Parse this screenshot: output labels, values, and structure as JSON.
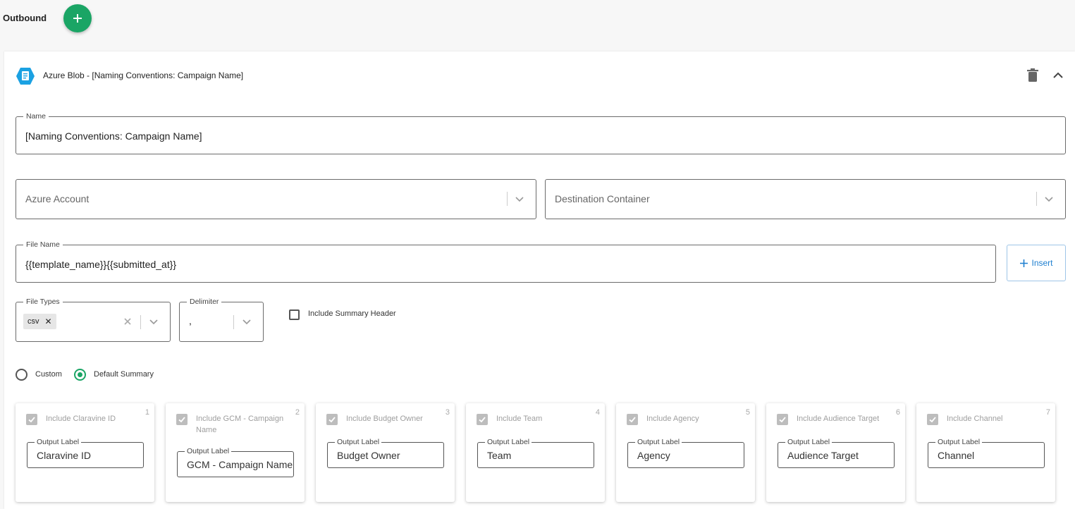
{
  "header": {
    "title": "Outbound",
    "add_icon": "plus-icon",
    "accent": "#1aa565"
  },
  "panel": {
    "title": "Azure Blob - [Naming Conventions: Campaign Name]",
    "icon": "azure-blob-icon",
    "name_field": {
      "label": "Name",
      "value": "[Naming Conventions: Campaign Name]"
    },
    "azure_account": {
      "placeholder": "Azure Account"
    },
    "destination_container": {
      "placeholder": "Destination Container"
    },
    "file_name": {
      "label": "File Name",
      "value": "{{template_name}}{{submitted_at}}"
    },
    "insert_label": "Insert",
    "file_types": {
      "label": "File Types",
      "chips": [
        "csv"
      ]
    },
    "delimiter": {
      "label": "Delimiter",
      "value": ","
    },
    "include_summary_header": "Include Summary Header",
    "radio_custom": "Custom",
    "radio_default": "Default Summary",
    "selected_radio": "Default Summary",
    "cards": [
      {
        "num": "1",
        "include": "Include Claravine ID",
        "output_label": "Output Label",
        "value": "Claravine ID"
      },
      {
        "num": "2",
        "include": "Include GCM - Campaign Name",
        "output_label": "Output Label",
        "value": "GCM - Campaign Name"
      },
      {
        "num": "3",
        "include": "Include Budget Owner",
        "output_label": "Output Label",
        "value": "Budget Owner"
      },
      {
        "num": "4",
        "include": "Include Team",
        "output_label": "Output Label",
        "value": "Team"
      },
      {
        "num": "5",
        "include": "Include Agency",
        "output_label": "Output Label",
        "value": "Agency"
      },
      {
        "num": "6",
        "include": "Include Audience Target",
        "output_label": "Output Label",
        "value": "Audience Target"
      },
      {
        "num": "7",
        "include": "Include Channel",
        "output_label": "Output Label",
        "value": "Channel"
      }
    ]
  }
}
